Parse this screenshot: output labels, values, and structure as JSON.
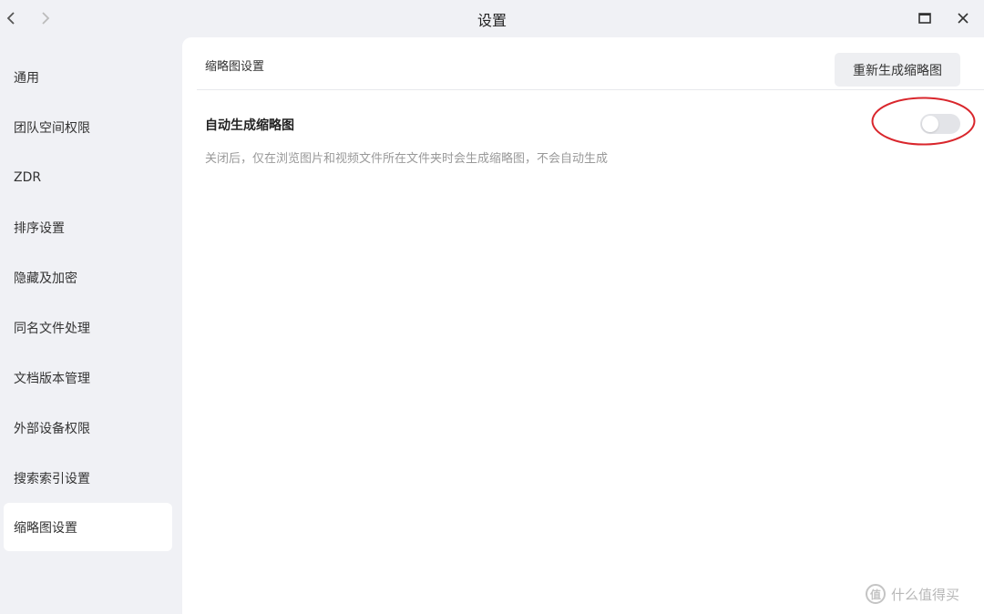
{
  "window": {
    "title": "设置"
  },
  "sidebar": {
    "items": [
      {
        "label": "通用"
      },
      {
        "label": "团队空间权限"
      },
      {
        "label": "ZDR"
      },
      {
        "label": "排序设置"
      },
      {
        "label": "隐藏及加密"
      },
      {
        "label": "同名文件处理"
      },
      {
        "label": "文档版本管理"
      },
      {
        "label": "外部设备权限"
      },
      {
        "label": "搜索索引设置"
      },
      {
        "label": "缩略图设置",
        "active": true
      }
    ]
  },
  "main": {
    "section_title": "缩略图设置",
    "regenerate_button": "重新生成缩略图",
    "option": {
      "label": "自动生成缩略图",
      "enabled": false,
      "description": "关闭后，仅在浏览图片和视频文件所在文件夹时会生成缩略图，不会自动生成"
    }
  },
  "annotation": {
    "color": "#d9262c"
  },
  "watermark": {
    "text": "什么值得买",
    "logo_glyph": "值"
  },
  "icons": {
    "back": "chevron-left-icon",
    "forward": "chevron-right-icon",
    "maximize": "maximize-icon",
    "close": "close-icon"
  }
}
